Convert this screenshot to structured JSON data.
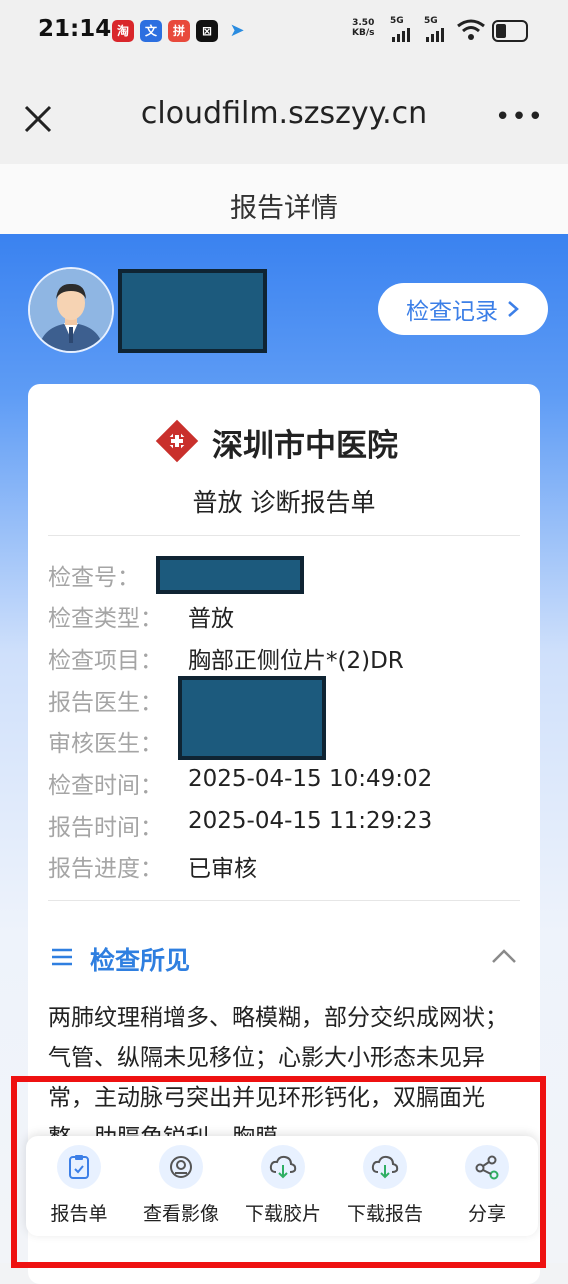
{
  "status_bar": {
    "time": "21:14",
    "net_speed_value": "3.50",
    "net_speed_unit": "KB/s",
    "signal1": "5G",
    "signal2": "5G"
  },
  "browser": {
    "url": "cloudfilm.szszyy.cn",
    "more": "•••"
  },
  "page": {
    "title": "报告详情"
  },
  "header": {
    "record_button": "检查记录"
  },
  "report": {
    "hospital": "深圳市中医院",
    "report_type": "普放 诊断报告单",
    "fields": [
      {
        "label": "检查号：",
        "value": ""
      },
      {
        "label": "检查类型：",
        "value": "普放"
      },
      {
        "label": "检查项目：",
        "value": "胸部正侧位片*(2)DR"
      },
      {
        "label": "报告医生：",
        "value": ""
      },
      {
        "label": "审核医生：",
        "value": ""
      },
      {
        "label": "检查时间：",
        "value": "2025-04-15 10:49:02"
      },
      {
        "label": "报告时间：",
        "value": "2025-04-15 11:29:23"
      },
      {
        "label": "报告进度：",
        "value": "已审核"
      }
    ]
  },
  "findings": {
    "title": "检查所见",
    "text": "两肺纹理稍增多、略模糊，部分交织成网状；气管、纵隔未见移位；心影大小形态未见异常，主动脉弓突出并见环形钙化，双膈面光整，肋膈角锐利。胸膜"
  },
  "toolbar": {
    "items": [
      {
        "label": "报告单",
        "icon": "clipboard-icon"
      },
      {
        "label": "查看影像",
        "icon": "image-viewer-icon"
      },
      {
        "label": "下载胶片",
        "icon": "cloud-download-icon"
      },
      {
        "label": "下载报告",
        "icon": "cloud-download-icon"
      },
      {
        "label": "分享",
        "icon": "share-icon"
      }
    ]
  },
  "colors": {
    "primary_blue": "#3a82f0",
    "link_blue": "#3c7fe7",
    "highlight_red": "#ee1111",
    "hospital_logo_red": "#c9302c"
  }
}
